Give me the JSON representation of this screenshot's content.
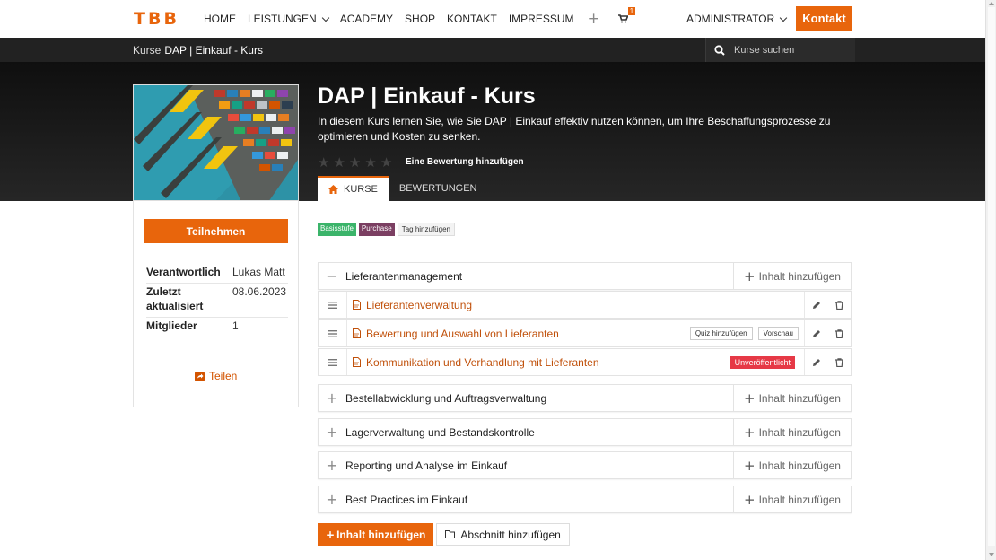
{
  "nav": {
    "logo": "TBB",
    "items": [
      {
        "label": "Home",
        "dropdown": false
      },
      {
        "label": "Leistungen",
        "dropdown": true
      },
      {
        "label": "Academy",
        "dropdown": false
      },
      {
        "label": "Shop",
        "dropdown": false
      },
      {
        "label": "Kontakt",
        "dropdown": false
      },
      {
        "label": "Impressum",
        "dropdown": false
      }
    ],
    "cart_count": "1",
    "user": "Administrator",
    "contact_button": "Kontakt"
  },
  "breadcrumb": {
    "root": "Kurse",
    "current": "DAP | Einkauf - Kurs"
  },
  "search": {
    "placeholder": "Kurse suchen"
  },
  "course": {
    "title": "DAP | Einkauf - Kurs",
    "description": "In diesem Kurs lernen Sie, wie Sie DAP | Einkauf effektiv nutzen können, um Ihre Beschaffungsprozesse zu optimieren und Kosten zu senken.",
    "rating_stars": 0,
    "rating_link": "Eine Bewertung hinzufügen"
  },
  "tabs": [
    {
      "label": "Kurse",
      "active": true
    },
    {
      "label": "Bewertungen",
      "active": false
    }
  ],
  "sidebar": {
    "join_button": "Teilnehmen",
    "meta": [
      {
        "key": "Verantwortlich",
        "value": "Lukas Matt"
      },
      {
        "key": "Zuletzt aktualisiert",
        "value": "08.06.2023"
      },
      {
        "key": "Mitglieder",
        "value": "1"
      }
    ],
    "share": "Teilen"
  },
  "tags": [
    {
      "label": "Basisstufe",
      "color": "#3bb46a"
    },
    {
      "label": "Purchase",
      "color": "#7b3f62"
    },
    {
      "label": "Tag hinzufügen",
      "color": "#f3f3f3"
    }
  ],
  "content": {
    "add_content_label": "Inhalt hinzufügen",
    "sections": [
      {
        "name": "Lieferantenmanagement",
        "expanded": true,
        "lessons": [
          {
            "name": "Lieferantenverwaltung",
            "buttons": [],
            "status": ""
          },
          {
            "name": "Bewertung und Auswahl von Lieferanten",
            "buttons": [
              "Quiz hinzufügen",
              "Vorschau"
            ],
            "status": ""
          },
          {
            "name": "Kommunikation und Verhandlung mit Lieferanten",
            "buttons": [],
            "status": "Unveröffentlicht"
          }
        ]
      },
      {
        "name": "Bestellabwicklung und Auftragsverwaltung",
        "expanded": false
      },
      {
        "name": "Lagerverwaltung und Bestandskontrolle",
        "expanded": false
      },
      {
        "name": "Reporting und Analyse im Einkauf",
        "expanded": false
      },
      {
        "name": "Best Practices im Einkauf",
        "expanded": false
      }
    ]
  },
  "footer_buttons": {
    "add_content": "Inhalt hinzufügen",
    "add_section": "Abschnitt hinzufügen"
  },
  "colors": {
    "accent": "#e8650c",
    "link": "#c0500a",
    "danger": "#e63946"
  }
}
